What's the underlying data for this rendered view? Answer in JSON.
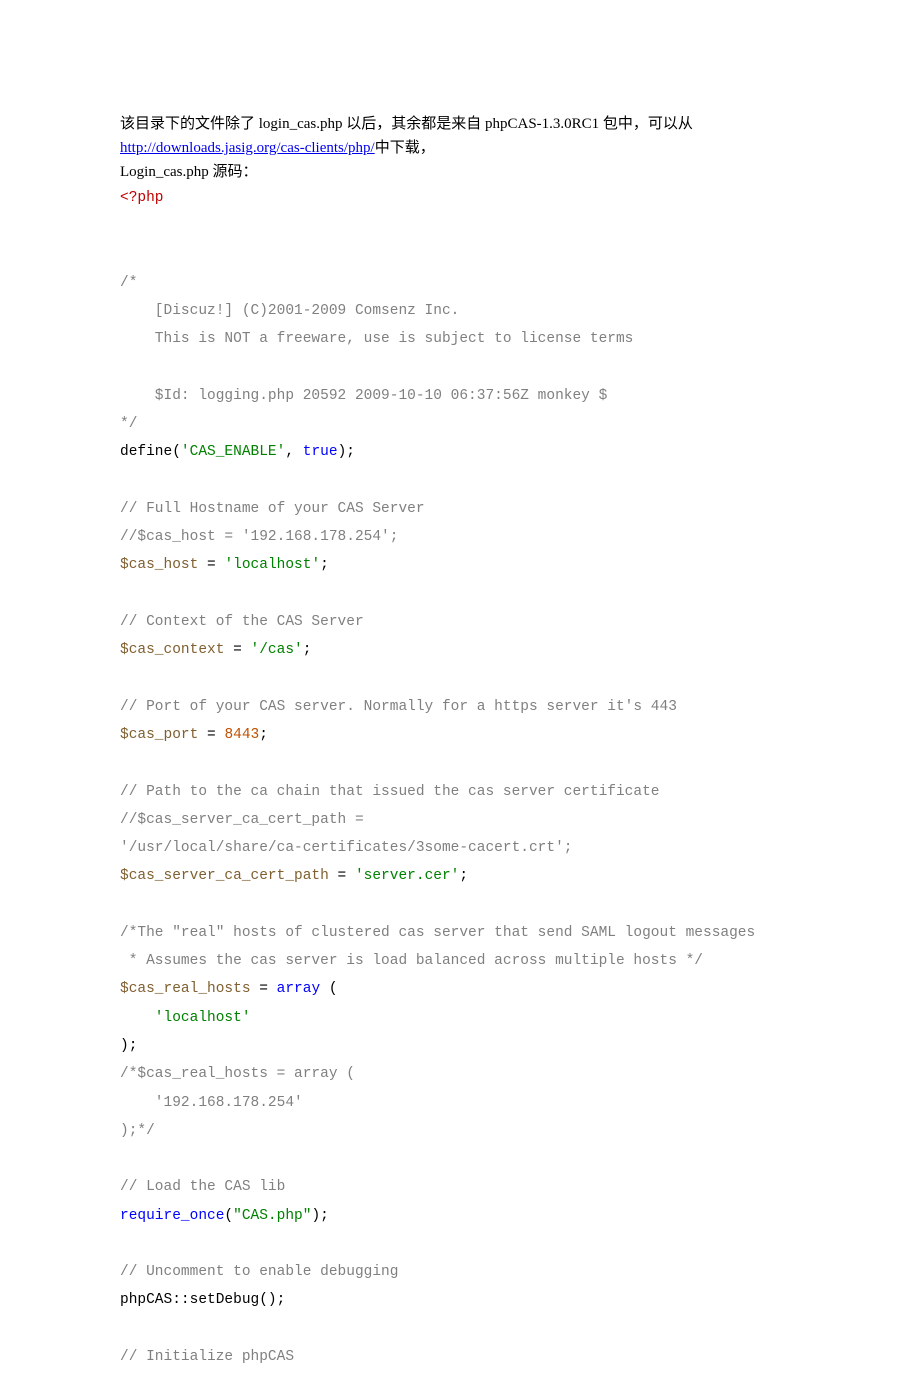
{
  "intro": {
    "line1_pre": "该目录下的文件除了 login_cas.php 以后，其余都是来自 phpCAS-1.3.0RC1 包中，可以从",
    "link_text": "http://downloads.jasig.org/cas-clients/php/",
    "link_suffix": "中下载，",
    "line2": "Login_cas.php 源码：",
    "php_open": "<?php"
  },
  "code": {
    "s": {
      "c_open": "/*",
      "c_l1": "    [Discuz!] (C)2001-2009 Comsenz Inc.",
      "c_l2": "    This is NOT a freeware, use is subject to license terms",
      "c_l3": "    $Id: logging.php 20592 2009-10-10 06:37:56Z monkey $",
      "c_close": "*/",
      "define_1": "define(",
      "define_str": "'CAS_ENABLE'",
      "define_comma": ", ",
      "define_true": "true",
      "define_end": ");",
      "h1": "// Full Hostname of your CAS Server",
      "h2": "//$cas_host = '192.168.178.254';",
      "hv": "$cas_host",
      "eq": " = ",
      "hval": "'localhost'",
      "semi": ";",
      "ctx_c": "// Context of the CAS Server",
      "ctxv": "$cas_context",
      "ctxval": "'/cas'",
      "port_c": "// Port of your CAS server. Normally for a https server it's 443",
      "portv": "$cas_port",
      "portval": "8443",
      "ca_c1": "// Path to the ca chain that issued the cas server certificate",
      "ca_c2": "//$cas_server_ca_cert_path =",
      "ca_c3": "'/usr/local/share/ca-certificates/3some-cacert.crt';",
      "cav": "$cas_server_ca_cert_path",
      "caval": "'server.cer'",
      "rh_c1": "/*The \"real\" hosts of clustered cas server that send SAML logout messages",
      "rh_c2": " * Assumes the cas server is load balanced across multiple hosts */",
      "rhv": "$cas_real_hosts",
      "rh_eq": " = ",
      "rh_array": "array",
      "rh_open": " (",
      "rh_item": "    'localhost'",
      "rh_close": ");",
      "rh_cmt1": "/*$cas_real_hosts = array (",
      "rh_cmt2": "    '192.168.178.254'",
      "rh_cmt3": ");*/",
      "lib_c": "// Load the CAS lib",
      "req": "require_once",
      "req_arg_open": "(",
      "req_str": "\"CAS.php\"",
      "req_end": ");",
      "dbg_c": "// Uncomment to enable debugging",
      "dbg": "phpCAS::setDebug();",
      "init_c": "// Initialize phpCAS"
    }
  }
}
